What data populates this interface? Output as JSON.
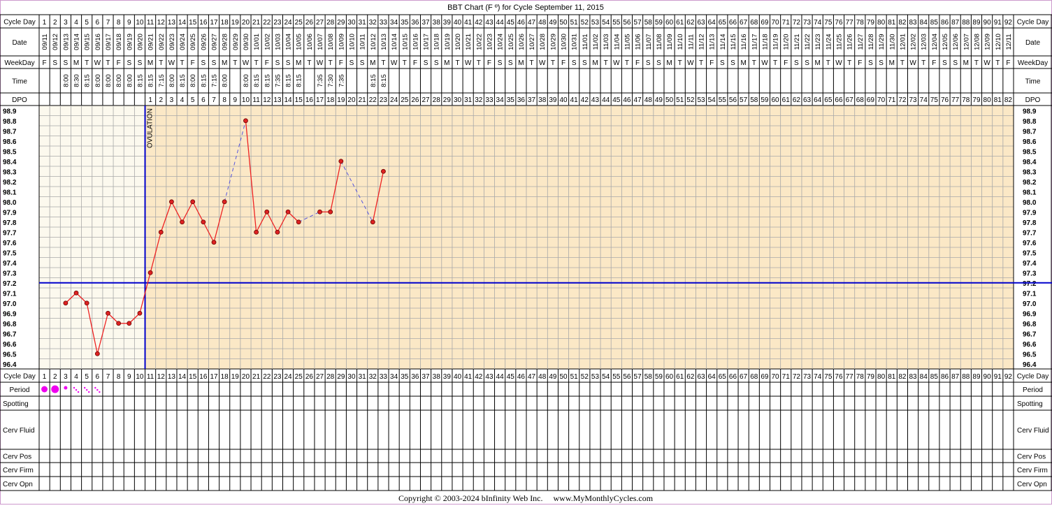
{
  "title": "BBT Chart (F º) for Cycle September 11, 2015",
  "footer": "Copyright © 2003-2024 bInfinity Web Inc.     www.MyMonthlyCycles.com",
  "row_labels": {
    "cycle_day": "Cycle Day",
    "date": "Date",
    "weekday": "WeekDay",
    "time": "Time",
    "dpo": "DPO",
    "period": "Period",
    "spotting": "Spotting",
    "cerv_fluid": "Cerv Fluid",
    "cerv_pos": "Cerv Pos",
    "cerv_firm": "Cerv Firm",
    "cerv_opn": "Cerv Opn"
  },
  "ovulation_label": "OVULATION",
  "colors": {
    "outer_border": "#cc99cc",
    "pre_ovulation_fill": "#fcf9ee",
    "post_ovulation_fill": "#fbe8c6",
    "grid": "#a8a8a8",
    "ovulation_line": "#0000cc",
    "coverline": "#0000cc",
    "temp_line": "#ee2222",
    "temp_point": "#dd2222",
    "gap_line": "#5555dd",
    "period_dot": "#ee00ee"
  },
  "dates": [
    "09/11",
    "09/12",
    "09/13",
    "09/14",
    "09/15",
    "09/16",
    "09/17",
    "09/18",
    "09/19",
    "09/20",
    "09/21",
    "09/22",
    "09/23",
    "09/24",
    "09/25",
    "09/26",
    "09/27",
    "09/28",
    "09/29",
    "09/30",
    "10/01",
    "10/02",
    "10/03",
    "10/04",
    "10/05",
    "10/06",
    "10/07",
    "10/08",
    "10/09",
    "10/10",
    "10/11",
    "10/12",
    "10/13",
    "10/14",
    "10/15",
    "10/16",
    "10/17",
    "10/18",
    "10/19",
    "10/20",
    "10/21",
    "10/22",
    "10/23",
    "10/24",
    "10/25",
    "10/26",
    "10/27",
    "10/28",
    "10/29",
    "10/30",
    "10/31",
    "11/01",
    "11/02",
    "11/03",
    "11/04",
    "11/05",
    "11/06",
    "11/07",
    "11/08",
    "11/09",
    "11/10",
    "11/11",
    "11/12",
    "11/13",
    "11/14",
    "11/15",
    "11/16",
    "11/17",
    "11/18",
    "11/19",
    "11/20",
    "11/21",
    "11/22",
    "11/23",
    "11/24",
    "11/25",
    "11/26",
    "11/27",
    "11/28",
    "11/29",
    "11/30",
    "12/01",
    "12/02",
    "12/03",
    "12/04",
    "12/05",
    "12/06",
    "12/07",
    "12/08",
    "12/09",
    "12/10",
    "12/11"
  ],
  "weekdays": [
    "F",
    "S",
    "S",
    "M",
    "T",
    "W",
    "T",
    "F",
    "S",
    "S",
    "M",
    "T",
    "W",
    "T",
    "F",
    "S",
    "S",
    "M",
    "T",
    "W",
    "T",
    "F",
    "S",
    "S",
    "M",
    "T",
    "W",
    "T",
    "F",
    "S",
    "S",
    "M",
    "T",
    "W",
    "T",
    "F",
    "S",
    "S",
    "M",
    "T",
    "W",
    "T",
    "F",
    "S",
    "S",
    "M",
    "T",
    "W",
    "T",
    "F",
    "S",
    "S",
    "M",
    "T",
    "W",
    "T",
    "F",
    "S",
    "S",
    "M",
    "T",
    "W",
    "T",
    "F",
    "S",
    "S",
    "M",
    "T",
    "W",
    "T",
    "F",
    "S",
    "S",
    "M",
    "T",
    "W",
    "T",
    "F",
    "S",
    "S",
    "M",
    "T",
    "W",
    "T",
    "F",
    "S",
    "S",
    "M",
    "T",
    "W",
    "T",
    "F"
  ],
  "times": [
    "",
    "",
    "8:00",
    "8:30",
    "8:15",
    "8:00",
    "8:00",
    "8:00",
    "8:00",
    "8:15",
    "8:15",
    "7:15",
    "8:00",
    "8:15",
    "8:00",
    "8:15",
    "7:15",
    "8:00",
    "",
    "8:00",
    "8:15",
    "8:15",
    "7:35",
    "8:15",
    "8:15",
    "",
    "7:35",
    "7:30",
    "7:35",
    "",
    "",
    "8:15",
    "8:15"
  ],
  "dpo_start_day": 11,
  "ovulation_day": 10,
  "coverline": 97.2,
  "period": [
    {
      "day": 1,
      "level": "medium"
    },
    {
      "day": 2,
      "level": "heavy"
    },
    {
      "day": 3,
      "level": "light"
    },
    {
      "day": 4,
      "level": "spotting"
    },
    {
      "day": 5,
      "level": "spotting"
    },
    {
      "day": 6,
      "level": "spotting"
    }
  ],
  "chart_data": {
    "type": "line",
    "title": "BBT Chart (F º) for Cycle September 11, 2015",
    "xlabel": "Cycle Day",
    "ylabel": "",
    "xlim": [
      1,
      92
    ],
    "ylim": [
      96.4,
      98.9
    ],
    "y_ticks": [
      98.9,
      98.8,
      98.7,
      98.6,
      98.5,
      98.4,
      98.3,
      98.2,
      98.1,
      98.0,
      97.9,
      97.8,
      97.7,
      97.6,
      97.5,
      97.4,
      97.3,
      97.2,
      97.1,
      97.0,
      96.9,
      96.8,
      96.7,
      96.6,
      96.5,
      96.4
    ],
    "grid": true,
    "series": [
      {
        "x": [
          3,
          4,
          5,
          6,
          7,
          8,
          9,
          10,
          11,
          12,
          13,
          14,
          15,
          16,
          17,
          18,
          20,
          21,
          22,
          23,
          24,
          25,
          27,
          28,
          29,
          32,
          33
        ],
        "y": [
          97.0,
          97.1,
          97.0,
          96.5,
          96.9,
          96.8,
          96.8,
          96.9,
          97.3,
          97.7,
          98.0,
          97.8,
          98.0,
          97.8,
          97.6,
          98.0,
          98.8,
          97.7,
          97.9,
          97.7,
          97.9,
          97.8,
          97.9,
          97.9,
          98.4,
          97.8,
          98.3
        ]
      }
    ]
  }
}
